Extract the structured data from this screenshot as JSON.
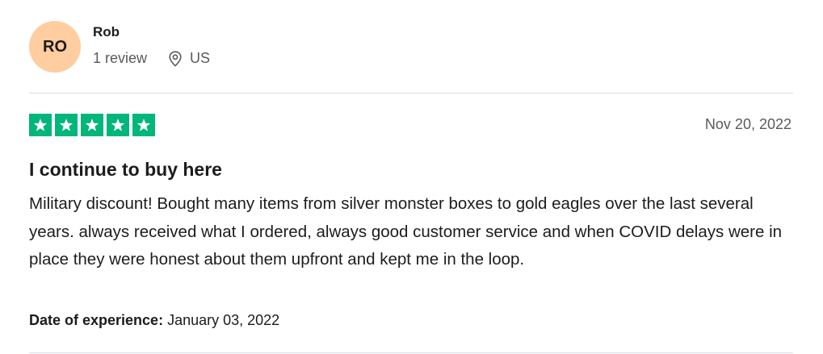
{
  "consumer": {
    "initials": "RO",
    "name": "Rob",
    "reviews_count": "1 review",
    "location": "US",
    "avatar_color": "#ffcd9f",
    "location_icon": "map-pin-icon"
  },
  "review": {
    "rating": 5,
    "rating_max": 5,
    "star_color": "#00b67a",
    "star_icon": "star-icon",
    "date": "Nov 20, 2022",
    "title": "I continue to buy here",
    "body": "Military discount! Bought many items from silver monster boxes to gold eagles over the last several years. always received what I ordered, always good customer service and when COVID delays were in place they were honest about them upfront and kept me in the loop.",
    "experience_label": "Date of experience:",
    "experience_date": "January 03, 2022"
  }
}
